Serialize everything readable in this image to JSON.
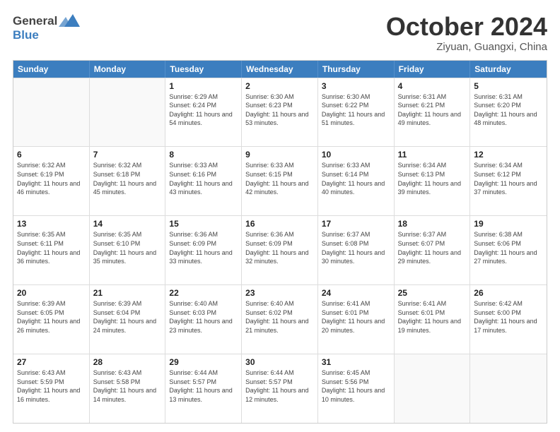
{
  "header": {
    "logo_general": "General",
    "logo_blue": "Blue",
    "month_title": "October 2024",
    "location": "Ziyuan, Guangxi, China"
  },
  "days_of_week": [
    "Sunday",
    "Monday",
    "Tuesday",
    "Wednesday",
    "Thursday",
    "Friday",
    "Saturday"
  ],
  "weeks": [
    [
      {
        "day": "",
        "info": ""
      },
      {
        "day": "",
        "info": ""
      },
      {
        "day": "1",
        "info": "Sunrise: 6:29 AM\nSunset: 6:24 PM\nDaylight: 11 hours and 54 minutes."
      },
      {
        "day": "2",
        "info": "Sunrise: 6:30 AM\nSunset: 6:23 PM\nDaylight: 11 hours and 53 minutes."
      },
      {
        "day": "3",
        "info": "Sunrise: 6:30 AM\nSunset: 6:22 PM\nDaylight: 11 hours and 51 minutes."
      },
      {
        "day": "4",
        "info": "Sunrise: 6:31 AM\nSunset: 6:21 PM\nDaylight: 11 hours and 49 minutes."
      },
      {
        "day": "5",
        "info": "Sunrise: 6:31 AM\nSunset: 6:20 PM\nDaylight: 11 hours and 48 minutes."
      }
    ],
    [
      {
        "day": "6",
        "info": "Sunrise: 6:32 AM\nSunset: 6:19 PM\nDaylight: 11 hours and 46 minutes."
      },
      {
        "day": "7",
        "info": "Sunrise: 6:32 AM\nSunset: 6:18 PM\nDaylight: 11 hours and 45 minutes."
      },
      {
        "day": "8",
        "info": "Sunrise: 6:33 AM\nSunset: 6:16 PM\nDaylight: 11 hours and 43 minutes."
      },
      {
        "day": "9",
        "info": "Sunrise: 6:33 AM\nSunset: 6:15 PM\nDaylight: 11 hours and 42 minutes."
      },
      {
        "day": "10",
        "info": "Sunrise: 6:33 AM\nSunset: 6:14 PM\nDaylight: 11 hours and 40 minutes."
      },
      {
        "day": "11",
        "info": "Sunrise: 6:34 AM\nSunset: 6:13 PM\nDaylight: 11 hours and 39 minutes."
      },
      {
        "day": "12",
        "info": "Sunrise: 6:34 AM\nSunset: 6:12 PM\nDaylight: 11 hours and 37 minutes."
      }
    ],
    [
      {
        "day": "13",
        "info": "Sunrise: 6:35 AM\nSunset: 6:11 PM\nDaylight: 11 hours and 36 minutes."
      },
      {
        "day": "14",
        "info": "Sunrise: 6:35 AM\nSunset: 6:10 PM\nDaylight: 11 hours and 35 minutes."
      },
      {
        "day": "15",
        "info": "Sunrise: 6:36 AM\nSunset: 6:09 PM\nDaylight: 11 hours and 33 minutes."
      },
      {
        "day": "16",
        "info": "Sunrise: 6:36 AM\nSunset: 6:09 PM\nDaylight: 11 hours and 32 minutes."
      },
      {
        "day": "17",
        "info": "Sunrise: 6:37 AM\nSunset: 6:08 PM\nDaylight: 11 hours and 30 minutes."
      },
      {
        "day": "18",
        "info": "Sunrise: 6:37 AM\nSunset: 6:07 PM\nDaylight: 11 hours and 29 minutes."
      },
      {
        "day": "19",
        "info": "Sunrise: 6:38 AM\nSunset: 6:06 PM\nDaylight: 11 hours and 27 minutes."
      }
    ],
    [
      {
        "day": "20",
        "info": "Sunrise: 6:39 AM\nSunset: 6:05 PM\nDaylight: 11 hours and 26 minutes."
      },
      {
        "day": "21",
        "info": "Sunrise: 6:39 AM\nSunset: 6:04 PM\nDaylight: 11 hours and 24 minutes."
      },
      {
        "day": "22",
        "info": "Sunrise: 6:40 AM\nSunset: 6:03 PM\nDaylight: 11 hours and 23 minutes."
      },
      {
        "day": "23",
        "info": "Sunrise: 6:40 AM\nSunset: 6:02 PM\nDaylight: 11 hours and 21 minutes."
      },
      {
        "day": "24",
        "info": "Sunrise: 6:41 AM\nSunset: 6:01 PM\nDaylight: 11 hours and 20 minutes."
      },
      {
        "day": "25",
        "info": "Sunrise: 6:41 AM\nSunset: 6:01 PM\nDaylight: 11 hours and 19 minutes."
      },
      {
        "day": "26",
        "info": "Sunrise: 6:42 AM\nSunset: 6:00 PM\nDaylight: 11 hours and 17 minutes."
      }
    ],
    [
      {
        "day": "27",
        "info": "Sunrise: 6:43 AM\nSunset: 5:59 PM\nDaylight: 11 hours and 16 minutes."
      },
      {
        "day": "28",
        "info": "Sunrise: 6:43 AM\nSunset: 5:58 PM\nDaylight: 11 hours and 14 minutes."
      },
      {
        "day": "29",
        "info": "Sunrise: 6:44 AM\nSunset: 5:57 PM\nDaylight: 11 hours and 13 minutes."
      },
      {
        "day": "30",
        "info": "Sunrise: 6:44 AM\nSunset: 5:57 PM\nDaylight: 11 hours and 12 minutes."
      },
      {
        "day": "31",
        "info": "Sunrise: 6:45 AM\nSunset: 5:56 PM\nDaylight: 11 hours and 10 minutes."
      },
      {
        "day": "",
        "info": ""
      },
      {
        "day": "",
        "info": ""
      }
    ]
  ]
}
